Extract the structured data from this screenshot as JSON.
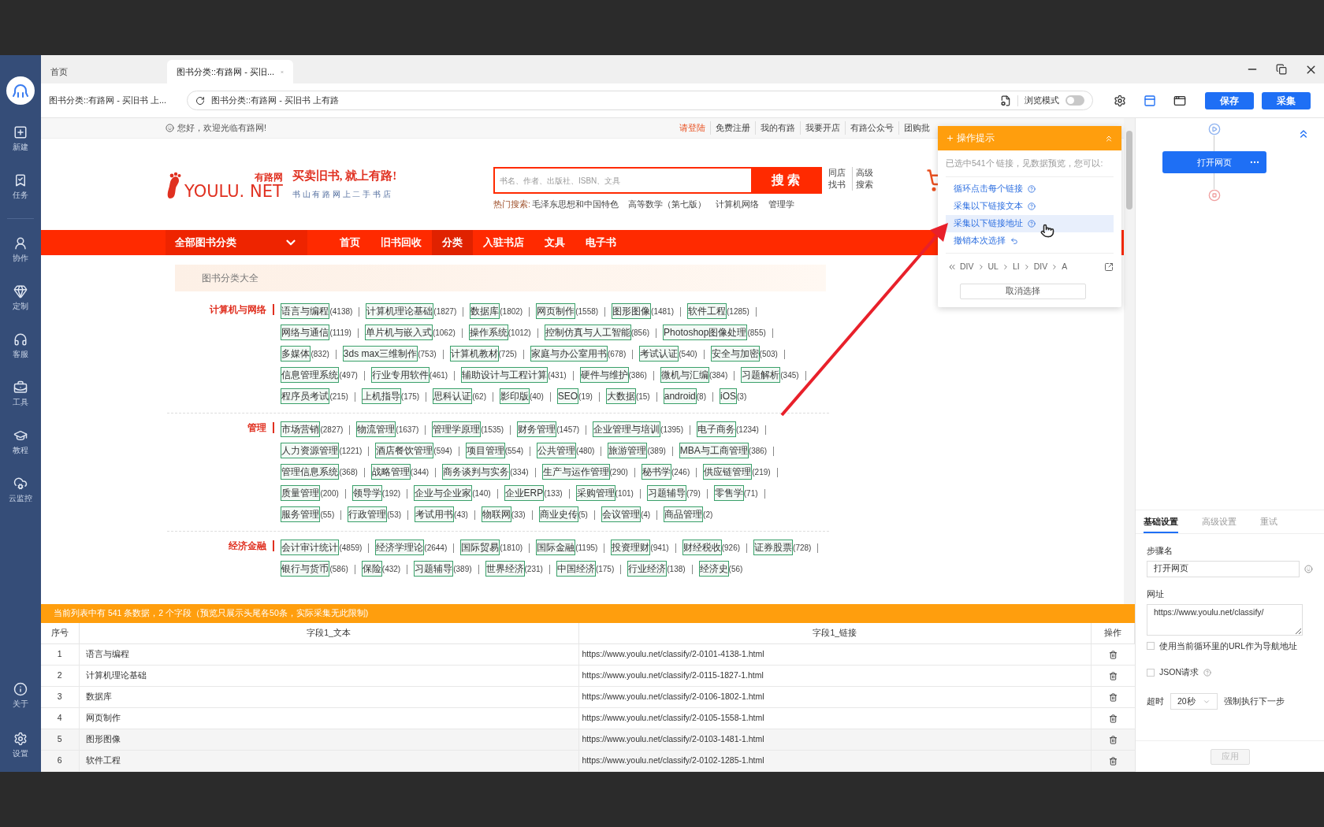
{
  "sidebar": {
    "items": [
      {
        "label": "新建"
      },
      {
        "label": "任务"
      },
      {
        "label": "协作"
      },
      {
        "label": "定制"
      },
      {
        "label": "客服"
      },
      {
        "label": "工具"
      },
      {
        "label": "教程"
      },
      {
        "label": "云监控"
      }
    ],
    "bottom_items": [
      {
        "label": "关于"
      },
      {
        "label": "设置"
      }
    ]
  },
  "browser_tabs": [
    {
      "label": "首页",
      "selected": false
    },
    {
      "label": "图书分类::有路网 - 买旧...",
      "selected": true
    }
  ],
  "address_row": {
    "page_title": "图书分类::有路网 - 买旧书 上...",
    "url": "图书分类::有路网 - 买旧书 上有路",
    "browse_mode": {
      "label": "浏览模式",
      "on": false
    }
  },
  "toolbar_buttons": [
    "保存",
    "采集"
  ],
  "webpage": {
    "welcome": "您好，欢迎光临有路网!",
    "top_links": [
      {
        "label": "请登陆",
        "highlight": true
      },
      {
        "label": "免费注册",
        "highlight": false
      },
      {
        "label": "我的有路",
        "highlight": false
      },
      {
        "label": "我要开店",
        "highlight": false
      },
      {
        "label": "有路公众号",
        "highlight": false
      },
      {
        "label": "团购批",
        "highlight": false
      }
    ],
    "logo": {
      "brand_cn": "有路网",
      "brand_en": "YOULU. NET",
      "slogan": "买卖旧书, 就上有路!",
      "tagline": "书 山 有 路 网 上 二 手 书 店"
    },
    "search": {
      "placeholder": "书名、作者、出版社、ISBN、文具",
      "button": "搜 索",
      "links": [
        "同店找书",
        "高级搜索"
      ]
    },
    "hot_search": {
      "label": "热门搜索:",
      "terms": [
        "毛泽东思想和中国特色",
        "高等数学（第七版）",
        "计算机网络",
        "管理学"
      ]
    },
    "nav": {
      "all_categories": "全部图书分类",
      "items": [
        {
          "label": "首页",
          "selected": false
        },
        {
          "label": "旧书回收",
          "selected": false
        },
        {
          "label": "分类",
          "selected": true
        },
        {
          "label": "入驻书店",
          "selected": false
        },
        {
          "label": "文具",
          "selected": false
        },
        {
          "label": "电子书",
          "selected": false
        }
      ]
    },
    "section_title": "图书分类大全",
    "categories": [
      {
        "name": "计算机与网络",
        "items": [
          {
            "name": "语言与编程",
            "count": "(4138)"
          },
          {
            "name": "计算机理论基础",
            "count": "(1827)"
          },
          {
            "name": "数据库",
            "count": "(1802)"
          },
          {
            "name": "网页制作",
            "count": "(1558)"
          },
          {
            "name": "图形图像",
            "count": "(1481)"
          },
          {
            "name": "软件工程",
            "count": "(1285)"
          },
          {
            "name": "网络与通信",
            "count": "(1119)"
          },
          {
            "name": "单片机与嵌入式",
            "count": "(1062)"
          },
          {
            "name": "操作系统",
            "count": "(1012)"
          },
          {
            "name": "控制仿真与人工智能",
            "count": "(856)"
          },
          {
            "name": "Photoshop图像处理",
            "count": "(855)"
          },
          {
            "name": "多媒体",
            "count": "(832)"
          },
          {
            "name": "3ds max三维制作",
            "count": "(753)"
          },
          {
            "name": "计算机教材",
            "count": "(725)"
          },
          {
            "name": "家庭与办公室用书",
            "count": "(678)"
          },
          {
            "name": "考试认证",
            "count": "(540)"
          },
          {
            "name": "安全与加密",
            "count": "(503)"
          },
          {
            "name": "信息管理系统",
            "count": "(497)"
          },
          {
            "name": "行业专用软件",
            "count": "(461)"
          },
          {
            "name": "辅助设计与工程计算",
            "count": "(431)"
          },
          {
            "name": "硬件与维护",
            "count": "(386)"
          },
          {
            "name": "微机与汇编",
            "count": "(384)"
          },
          {
            "name": "习题解析",
            "count": "(345)"
          },
          {
            "name": "程序员考试",
            "count": "(215)"
          },
          {
            "name": "上机指导",
            "count": "(175)"
          },
          {
            "name": "思科认证",
            "count": "(62)"
          },
          {
            "name": "影印版",
            "count": "(40)"
          },
          {
            "name": "SEO",
            "count": "(19)"
          },
          {
            "name": "大数据",
            "count": "(15)"
          },
          {
            "name": "android",
            "count": "(8)"
          },
          {
            "name": "iOS",
            "count": "(3)"
          }
        ]
      },
      {
        "name": "管理",
        "items": [
          {
            "name": "市场营销",
            "count": "(2827)"
          },
          {
            "name": "物流管理",
            "count": "(1637)"
          },
          {
            "name": "管理学原理",
            "count": "(1535)"
          },
          {
            "name": "财务管理",
            "count": "(1457)"
          },
          {
            "name": "企业管理与培训",
            "count": "(1395)"
          },
          {
            "name": "电子商务",
            "count": "(1234)"
          },
          {
            "name": "人力资源管理",
            "count": "(1221)"
          },
          {
            "name": "酒店餐饮管理",
            "count": "(594)"
          },
          {
            "name": "项目管理",
            "count": "(554)"
          },
          {
            "name": "公共管理",
            "count": "(480)"
          },
          {
            "name": "旅游管理",
            "count": "(389)"
          },
          {
            "name": "MBA与工商管理",
            "count": "(386)"
          },
          {
            "name": "管理信息系统",
            "count": "(368)"
          },
          {
            "name": "战略管理",
            "count": "(344)"
          },
          {
            "name": "商务谈判与实务",
            "count": "(334)"
          },
          {
            "name": "生产与运作管理",
            "count": "(290)"
          },
          {
            "name": "秘书学",
            "count": "(246)"
          },
          {
            "name": "供应链管理",
            "count": "(219)"
          },
          {
            "name": "质量管理",
            "count": "(200)"
          },
          {
            "name": "领导学",
            "count": "(192)"
          },
          {
            "name": "企业与企业家",
            "count": "(140)"
          },
          {
            "name": "企业ERP",
            "count": "(133)"
          },
          {
            "name": "采购管理",
            "count": "(101)"
          },
          {
            "name": "习题辅导",
            "count": "(79)"
          },
          {
            "name": "零售学",
            "count": "(71)"
          },
          {
            "name": "服务管理",
            "count": "(55)"
          },
          {
            "name": "行政管理",
            "count": "(53)"
          },
          {
            "name": "考试用书",
            "count": "(43)"
          },
          {
            "name": "物联网",
            "count": "(33)"
          },
          {
            "name": "商业史传",
            "count": "(5)"
          },
          {
            "name": "会议管理",
            "count": "(4)"
          },
          {
            "name": "商品管理",
            "count": "(2)"
          }
        ]
      },
      {
        "name": "经济金融",
        "items": [
          {
            "name": "会计审计统计",
            "count": "(4859)"
          },
          {
            "name": "经济学理论",
            "count": "(2644)"
          },
          {
            "name": "国际贸易",
            "count": "(1810)"
          },
          {
            "name": "国际金融",
            "count": "(1195)"
          },
          {
            "name": "投资理财",
            "count": "(941)"
          },
          {
            "name": "财经税收",
            "count": "(926)"
          },
          {
            "name": "证券股票",
            "count": "(728)"
          },
          {
            "name": "银行与货币",
            "count": "(586)"
          },
          {
            "name": "保险",
            "count": "(432)"
          },
          {
            "name": "习题辅导",
            "count": "(389)"
          },
          {
            "name": "世界经济",
            "count": "(231)"
          },
          {
            "name": "中国经济",
            "count": "(175)"
          },
          {
            "name": "行业经济",
            "count": "(138)"
          },
          {
            "name": "经济史",
            "count": "(56)"
          }
        ]
      }
    ]
  },
  "popup": {
    "title": "操作提示",
    "summary": "已选中541个 链接，见数据预览，您可以:",
    "actions": [
      {
        "label": "循环点击每个链接",
        "kind": "help",
        "selected": false
      },
      {
        "label": "采集以下链接文本",
        "kind": "help",
        "selected": false
      },
      {
        "label": "采集以下链接地址",
        "kind": "help",
        "selected": true
      },
      {
        "label": "撤销本次选择",
        "kind": "undo",
        "selected": false
      }
    ],
    "breadcrumb": [
      "DIV",
      "UL",
      "LI",
      "DIV",
      "A"
    ],
    "cancel": "取消选择"
  },
  "data_preview": {
    "notice": "当前列表中有 541 条数据，2 个字段（预览只展示头尾各50条，实际采集无此限制)",
    "columns": [
      "序号",
      "字段1_文本",
      "字段1_链接",
      "操作"
    ],
    "rows": [
      {
        "index": "1",
        "text": "语言与编程",
        "url": "https://www.youlu.net/classify/2-0101-4138-1.html"
      },
      {
        "index": "2",
        "text": "计算机理论基础",
        "url": "https://www.youlu.net/classify/2-0115-1827-1.html"
      },
      {
        "index": "3",
        "text": "数据库",
        "url": "https://www.youlu.net/classify/2-0106-1802-1.html"
      },
      {
        "index": "4",
        "text": "网页制作",
        "url": "https://www.youlu.net/classify/2-0105-1558-1.html"
      },
      {
        "index": "5",
        "text": "图形图像",
        "url": "https://www.youlu.net/classify/2-0103-1481-1.html"
      },
      {
        "index": "6",
        "text": "软件工程",
        "url": "https://www.youlu.net/classify/2-0102-1285-1.html"
      }
    ]
  },
  "workflow": {
    "node": "打开网页"
  },
  "settings": {
    "tabs": [
      {
        "label": "基础设置",
        "selected": true
      },
      {
        "label": "高级设置",
        "selected": false
      },
      {
        "label": "重试",
        "selected": false
      }
    ],
    "step_name_label": "步骤名",
    "step_name": "打开网页",
    "url_label": "网址",
    "url": "https://www.youlu.net/classify/",
    "checkboxes": [
      {
        "label": "使用当前循环里的URL作为导航地址",
        "checked": false,
        "help": false
      },
      {
        "label": "JSON请求",
        "checked": false,
        "help": true
      }
    ],
    "timeout_label": "超时",
    "timeout": "20秒",
    "force_label": "强制执行下一步",
    "apply": "应用",
    "apply_disabled": true
  }
}
